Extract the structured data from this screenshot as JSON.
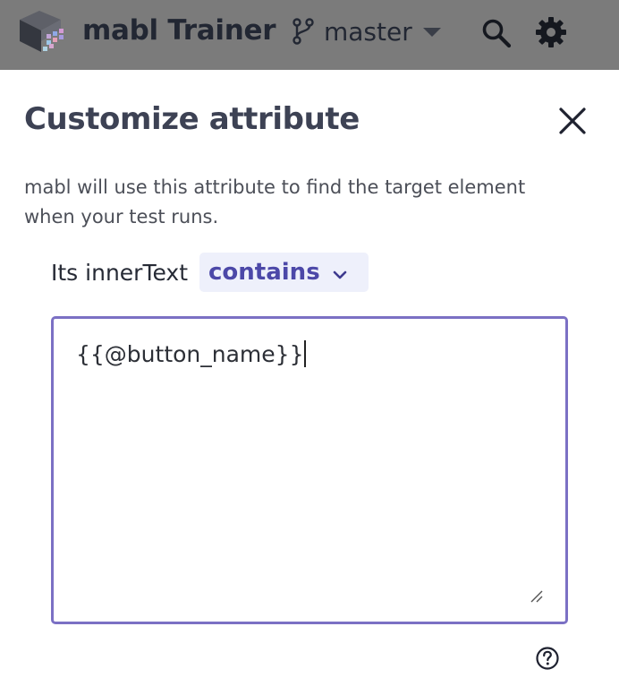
{
  "app": {
    "title": "mabl Trainer"
  },
  "header": {
    "branch_label": "master",
    "icons": [
      "mabl-logo",
      "branch-icon",
      "chevron-down-icon",
      "search-icon",
      "gear-icon"
    ]
  },
  "panel": {
    "title": "Customize attribute",
    "description": "mabl will use this attribute to find the target element when your test runs.",
    "attribute_label": "Its innerText",
    "operator_value": "contains",
    "value_text": "{{@button_name}}"
  },
  "colors": {
    "header_bg": "#7b7b7b",
    "accent": "#4c48a8",
    "input_border": "#7b70c4",
    "operator_bg": "#eef0fb"
  }
}
